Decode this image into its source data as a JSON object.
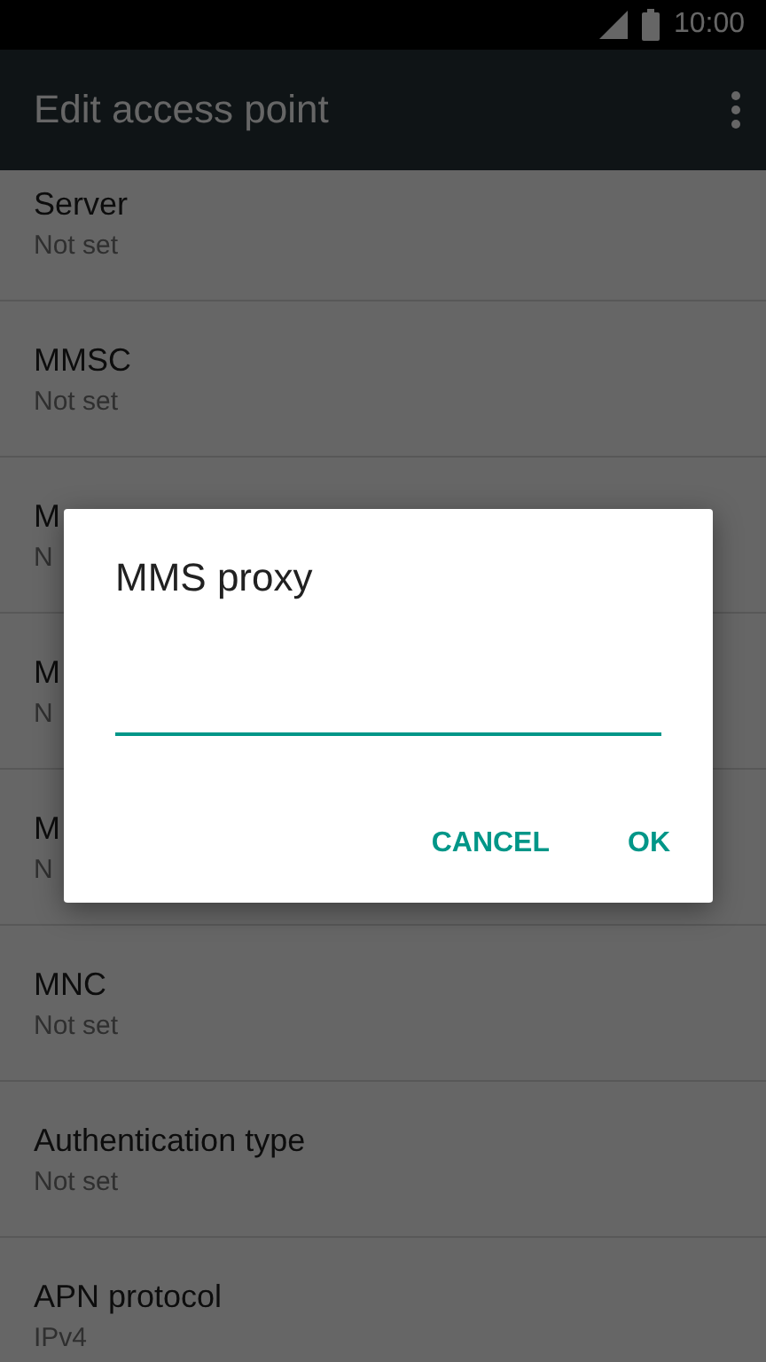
{
  "status_bar": {
    "time": "10:00"
  },
  "app_bar": {
    "title": "Edit access point"
  },
  "settings": [
    {
      "title": "Server",
      "value": "Not set"
    },
    {
      "title": "MMSC",
      "value": "Not set"
    },
    {
      "title": "M",
      "value": "N"
    },
    {
      "title": "M",
      "value": "N"
    },
    {
      "title": "M",
      "value": "N"
    },
    {
      "title": "MNC",
      "value": "Not set"
    },
    {
      "title": "Authentication type",
      "value": "Not set"
    },
    {
      "title": "APN protocol",
      "value": "IPv4"
    }
  ],
  "dialog": {
    "title": "MMS proxy",
    "buttons": [
      "CANCEL",
      "OK"
    ]
  }
}
